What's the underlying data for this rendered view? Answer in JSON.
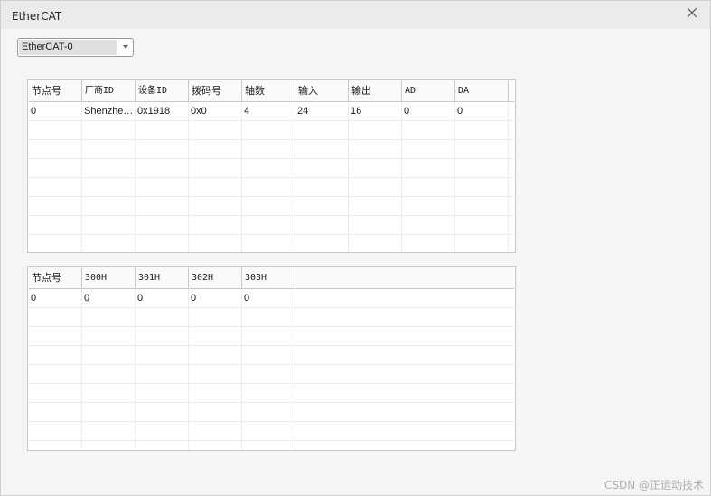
{
  "window": {
    "title": "EtherCAT",
    "close_glyph": "✕"
  },
  "selector": {
    "value": "EtherCAT-0"
  },
  "table1": {
    "headers": [
      "节点号",
      "厂商ID",
      "设备ID",
      "拨码号",
      "轴数",
      "输入",
      "输出",
      "AD",
      "DA"
    ],
    "rows": [
      [
        "0",
        "Shenzhe…",
        "0x1918",
        "0x0",
        "4",
        "24",
        "16",
        "0",
        "0"
      ]
    ]
  },
  "table2": {
    "headers": [
      "节点号",
      "300H",
      "301H",
      "302H",
      "303H"
    ],
    "rows": [
      [
        "0",
        "0",
        "0",
        "0",
        "0"
      ]
    ]
  },
  "watermark": "CSDN @正运动技术"
}
